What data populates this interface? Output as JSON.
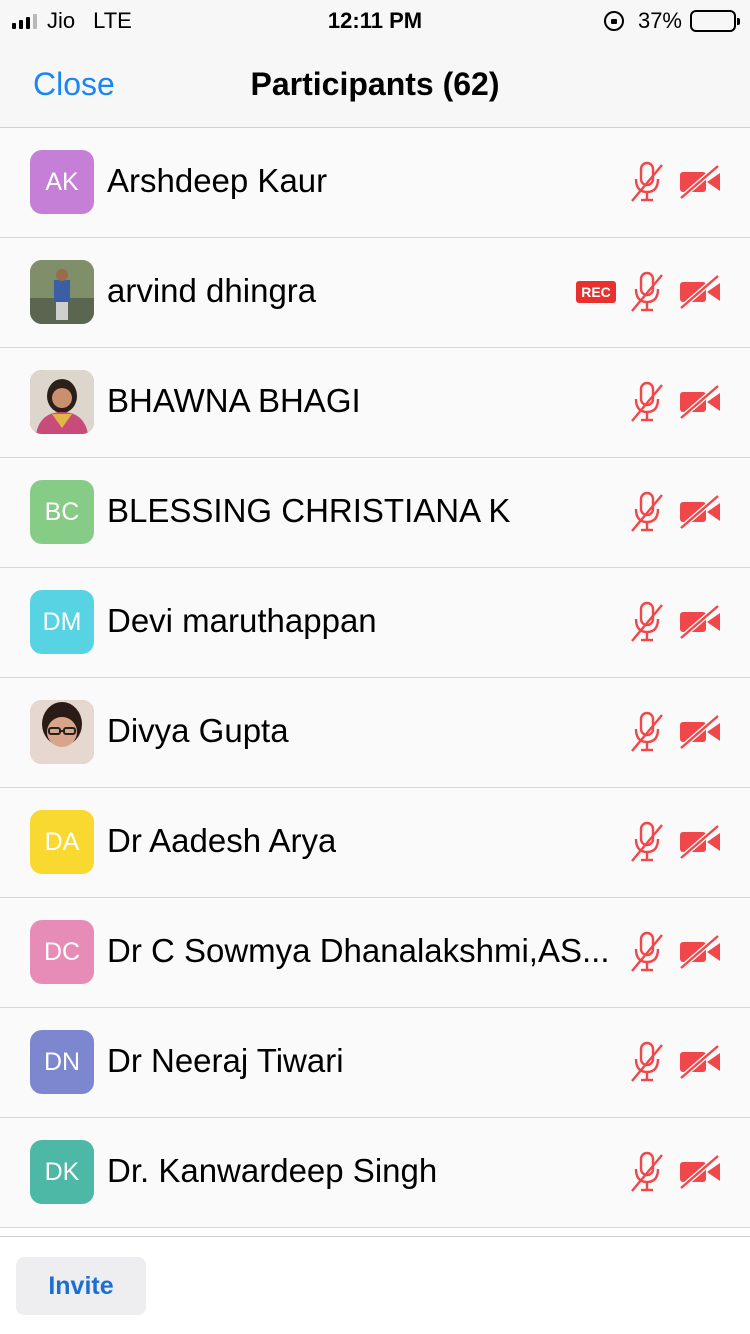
{
  "status_bar": {
    "carrier": "Jio",
    "network": "LTE",
    "time": "12:11 PM",
    "battery_percent": "37%",
    "battery_level": 0.37
  },
  "nav": {
    "close_label": "Close",
    "title": "Participants (62)"
  },
  "participants": [
    {
      "initials": "AK",
      "name": "Arshdeep Kaur",
      "avatar_color": "#c57fd6",
      "photo": false,
      "rec": false,
      "muted": true,
      "video_off": true
    },
    {
      "initials": "",
      "name": "arvind dhingra",
      "avatar_color": "#6a7a5e",
      "photo": true,
      "rec": true,
      "rec_label": "REC",
      "muted": true,
      "video_off": true
    },
    {
      "initials": "",
      "name": "BHAWNA BHAGI",
      "avatar_color": "#b75a7c",
      "photo": true,
      "rec": false,
      "muted": true,
      "video_off": true
    },
    {
      "initials": "BC",
      "name": "BLESSING CHRISTIANA K",
      "avatar_color": "#86cc86",
      "photo": false,
      "rec": false,
      "muted": true,
      "video_off": true
    },
    {
      "initials": "DM",
      "name": "Devi maruthappan",
      "avatar_color": "#57d3e3",
      "photo": false,
      "rec": false,
      "muted": true,
      "video_off": true
    },
    {
      "initials": "",
      "name": "Divya Gupta",
      "avatar_color": "#c99880",
      "photo": true,
      "rec": false,
      "muted": true,
      "video_off": true
    },
    {
      "initials": "DA",
      "name": "Dr Aadesh Arya",
      "avatar_color": "#f9d92f",
      "photo": false,
      "rec": false,
      "muted": true,
      "video_off": true
    },
    {
      "initials": "DC",
      "name": "Dr C Sowmya Dhanalakshmi,AS...",
      "avatar_color": "#e68cb7",
      "photo": false,
      "rec": false,
      "muted": true,
      "video_off": true
    },
    {
      "initials": "DN",
      "name": "Dr Neeraj Tiwari",
      "avatar_color": "#7d87cf",
      "photo": false,
      "rec": false,
      "muted": true,
      "video_off": true
    },
    {
      "initials": "DK",
      "name": "Dr. Kanwardeep Singh",
      "avatar_color": "#4db8a5",
      "photo": false,
      "rec": false,
      "muted": true,
      "video_off": true
    }
  ],
  "footer": {
    "invite_label": "Invite"
  },
  "colors": {
    "accent": "#1a86f4",
    "muted_icon": "#f0484a",
    "rec_badge": "#e8302e"
  },
  "icons": {
    "mic": "mic-muted-icon",
    "cam": "video-off-icon",
    "close": "close-button"
  }
}
